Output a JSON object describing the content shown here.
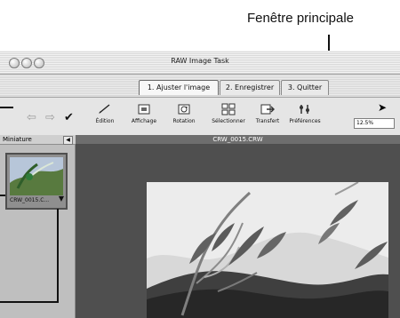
{
  "callout": {
    "label": "Fenêtre principale"
  },
  "window": {
    "title": "RAW Image Task"
  },
  "tabs": [
    {
      "label": "1. Ajuster l'image"
    },
    {
      "label": "2. Enregistrer"
    },
    {
      "label": "3. Quitter"
    }
  ],
  "toolbar": {
    "items": [
      {
        "label": "Édition",
        "icon": "edit-icon"
      },
      {
        "label": "Affichage",
        "icon": "view-icon"
      },
      {
        "label": "Rotation",
        "icon": "rotate-icon"
      },
      {
        "label": "Sélectionner",
        "icon": "select-icon"
      },
      {
        "label": "Transfert",
        "icon": "transfer-icon"
      },
      {
        "label": "Préférences",
        "icon": "preferences-icon"
      }
    ],
    "zoom": "12.5%"
  },
  "sidebar": {
    "header": "Miniature",
    "collapse_icon": "◀",
    "thumbnail_label": "CRW_0015.C..."
  },
  "viewer": {
    "filename": "CRW_0015.CRW"
  }
}
